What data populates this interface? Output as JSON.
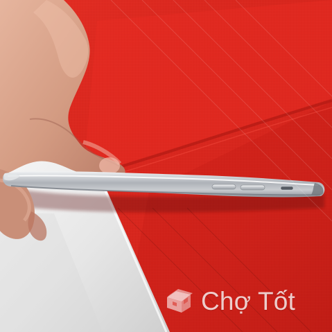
{
  "image": {
    "watermark": {
      "text": "Chợ Tốt",
      "icon": "cho-tot-logo-icon"
    }
  },
  "colors": {
    "fabric_red": "#d7261c",
    "fabric_dark_red": "#a81410",
    "white_sheet": "#ececec",
    "skin": "#d9a28a",
    "phone_silver": "#b8bcc2"
  }
}
